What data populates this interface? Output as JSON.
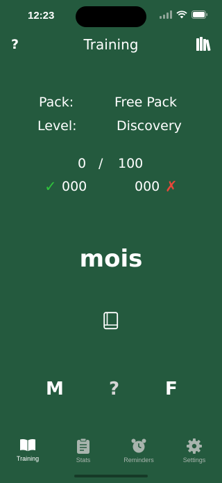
{
  "status_bar": {
    "time": "12:23"
  },
  "nav": {
    "help_label": "?",
    "title": "Training",
    "library_icon": "books-icon"
  },
  "info": {
    "pack_label": "Pack:",
    "pack_value": "Free Pack",
    "level_label": "Level:",
    "level_value": "Discovery"
  },
  "progress": {
    "current": "0",
    "separator": "/",
    "total": "100"
  },
  "score": {
    "correct_mark": "✓",
    "correct": "000",
    "wrong": "000",
    "wrong_mark": "✗"
  },
  "word": "mois",
  "answers": {
    "masculine": "M",
    "unknown": "?",
    "feminine": "F"
  },
  "tabs": [
    {
      "label": "Training",
      "icon": "book-open-icon",
      "active": true
    },
    {
      "label": "Stats",
      "icon": "clipboard-icon",
      "active": false
    },
    {
      "label": "Reminders",
      "icon": "alarm-clock-icon",
      "active": false
    },
    {
      "label": "Settings",
      "icon": "gear-icon",
      "active": false
    }
  ],
  "colors": {
    "background": "#245a3e",
    "correct": "#2fc43c",
    "wrong": "#e8483a",
    "tab_inactive": "#a8b4ad"
  }
}
